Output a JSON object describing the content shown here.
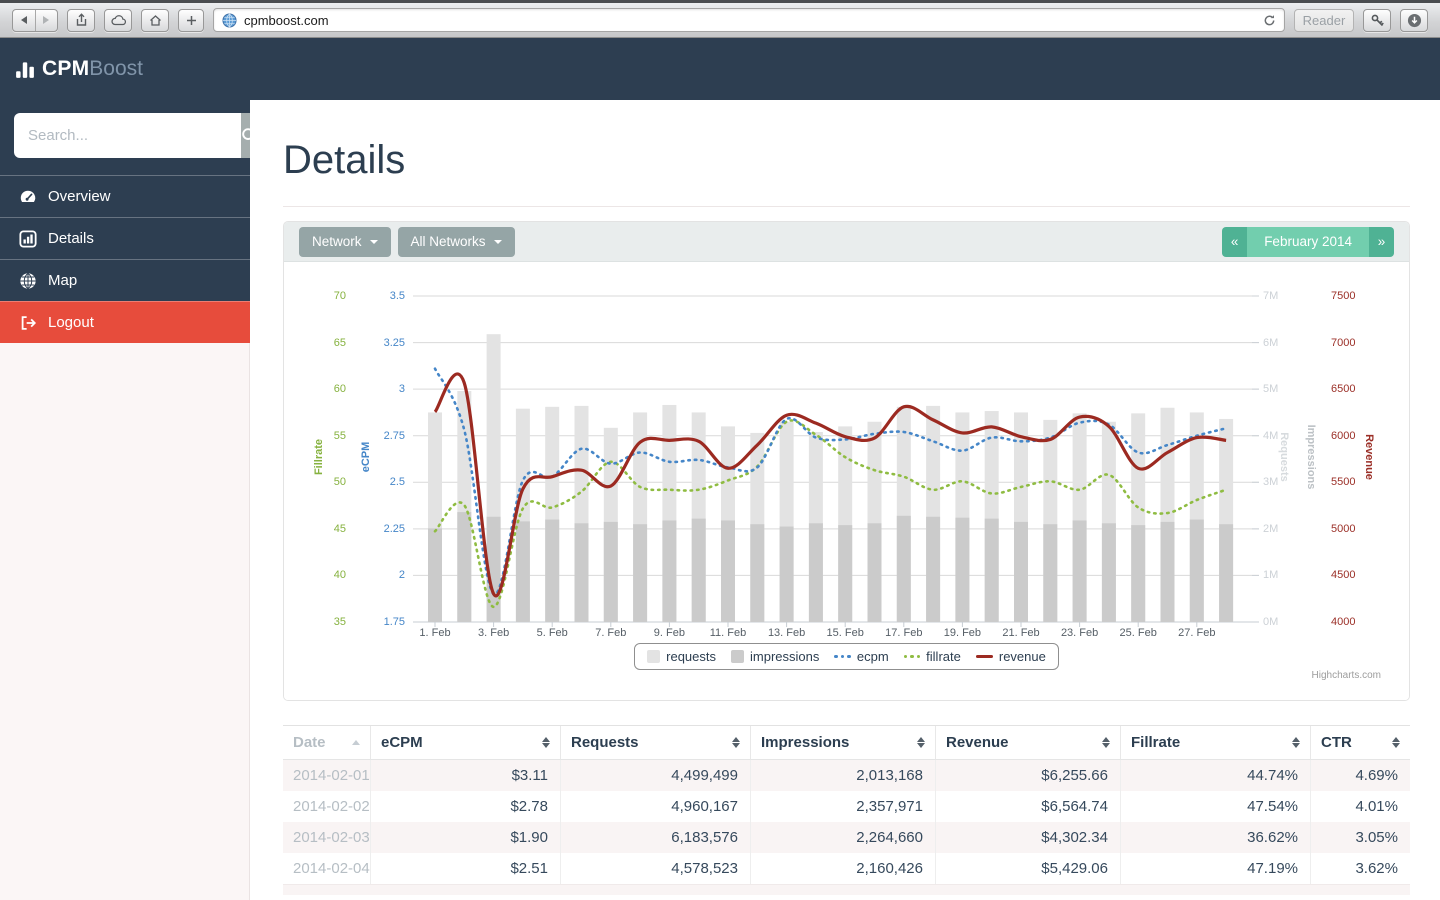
{
  "browser": {
    "url": "cpmboost.com",
    "reader_label": "Reader"
  },
  "navbar": {
    "brand_bold": "CPM",
    "brand_light": "Boost"
  },
  "sidebar": {
    "search_placeholder": "Search...",
    "items": [
      {
        "label": "Overview",
        "icon": "gauge-icon"
      },
      {
        "label": "Details",
        "icon": "bar-chart-icon"
      },
      {
        "label": "Map",
        "icon": "globe-icon"
      },
      {
        "label": "Logout",
        "icon": "logout-icon",
        "variant": "danger"
      }
    ]
  },
  "main": {
    "title": "Details",
    "toolbar": {
      "network_button": "Network",
      "all_networks_button": "All Networks",
      "pagination": {
        "prev": "«",
        "current": "February 2014",
        "next": "»"
      }
    },
    "credit": "Highcharts.com"
  },
  "chart_data": {
    "type": "combo",
    "x_tick_labels": [
      "1. Feb",
      "3. Feb",
      "5. Feb",
      "7. Feb",
      "9. Feb",
      "11. Feb",
      "13. Feb",
      "15. Feb",
      "17. Feb",
      "19. Feb",
      "21. Feb",
      "23. Feb",
      "25. Feb",
      "27. Feb"
    ],
    "days": 28,
    "series": [
      {
        "name": "requests",
        "type": "bar",
        "unit": "millions",
        "values": [
          4.5,
          4.96,
          6.18,
          4.58,
          4.62,
          4.64,
          4.17,
          4.5,
          4.66,
          4.5,
          4.2,
          4.06,
          4.3,
          4.08,
          4.2,
          4.3,
          4.62,
          4.64,
          4.5,
          4.53,
          4.5,
          4.34,
          4.48,
          4.3,
          4.48,
          4.6,
          4.5,
          4.36
        ]
      },
      {
        "name": "impressions",
        "type": "bar",
        "unit": "millions",
        "values": [
          2.01,
          2.36,
          2.26,
          2.16,
          2.2,
          2.12,
          2.15,
          2.1,
          2.18,
          2.22,
          2.18,
          2.1,
          2.05,
          2.12,
          2.08,
          2.12,
          2.28,
          2.26,
          2.24,
          2.22,
          2.15,
          2.1,
          2.18,
          2.12,
          2.08,
          2.15,
          2.2,
          2.1
        ]
      },
      {
        "name": "ecpm",
        "type": "dotted-line",
        "values": [
          3.11,
          2.78,
          1.9,
          2.51,
          2.53,
          2.68,
          2.6,
          2.66,
          2.61,
          2.62,
          2.58,
          2.58,
          2.84,
          2.74,
          2.73,
          2.76,
          2.77,
          2.72,
          2.67,
          2.74,
          2.72,
          2.74,
          2.82,
          2.81,
          2.66,
          2.7,
          2.75,
          2.79
        ]
      },
      {
        "name": "fillrate",
        "type": "dotted-line",
        "values": [
          44.74,
          47.54,
          36.62,
          47.19,
          47.3,
          49.0,
          52.2,
          49.5,
          49.2,
          49.2,
          50.2,
          51.7,
          56.5,
          55.1,
          52.7,
          51.3,
          50.6,
          49.2,
          50.1,
          48.8,
          49.5,
          50.1,
          49.2,
          50.8,
          47.3,
          46.7,
          48.1,
          49.2
        ]
      },
      {
        "name": "revenue",
        "type": "line",
        "values": [
          6255.66,
          6564.74,
          4302.34,
          5429.06,
          5560,
          5630,
          5460,
          5930,
          5950,
          5940,
          5650,
          5900,
          6220,
          6135,
          5990,
          5975,
          6310,
          6170,
          6030,
          6095,
          5990,
          5960,
          6200,
          6100,
          5650,
          5820,
          5980,
          5950
        ]
      }
    ],
    "axes": {
      "fillrate": {
        "title": "Fillrate",
        "color": "#86b23f",
        "min": 35,
        "max": 70,
        "ticks": [
          "70",
          "65",
          "60",
          "55",
          "50",
          "45",
          "40",
          "35"
        ]
      },
      "ecpm": {
        "title": "eCPM",
        "color": "#4586c8",
        "min": 1.75,
        "max": 3.5,
        "ticks": [
          "3.5",
          "3.25",
          "3",
          "2.75",
          "2.5",
          "2.25",
          "2",
          "1.75"
        ]
      },
      "volume": {
        "titles": [
          "Requests",
          "Impressions"
        ],
        "colors": [
          "#d7dbde",
          "#bcc1c5"
        ],
        "tick_color": "#ccd1d6",
        "min": 0,
        "max": 7,
        "ticks": [
          "7M",
          "6M",
          "5M",
          "4M",
          "3M",
          "2M",
          "1M",
          "0M"
        ]
      },
      "revenue": {
        "title": "Revenue",
        "color": "#9b2f27",
        "min": 4000,
        "max": 7500,
        "ticks": [
          "7500",
          "7000",
          "6500",
          "6000",
          "5500",
          "5000",
          "4500",
          "4000"
        ]
      }
    },
    "legend": [
      {
        "label": "requests",
        "swatch": "square",
        "color": "#e3e3e3"
      },
      {
        "label": "impressions",
        "swatch": "square",
        "color": "#cbcbcb"
      },
      {
        "label": "ecpm",
        "swatch": "dots",
        "color": "#4586c8"
      },
      {
        "label": "fillrate",
        "swatch": "dots",
        "color": "#8fbc42"
      },
      {
        "label": "revenue",
        "swatch": "line",
        "color": "#9c2a21"
      }
    ],
    "grid": true,
    "legend_position": "bottom-center"
  },
  "table": {
    "columns": [
      {
        "label": "Date",
        "sort": "asc"
      },
      {
        "label": "eCPM",
        "sort": "both"
      },
      {
        "label": "Requests",
        "sort": "both"
      },
      {
        "label": "Impressions",
        "sort": "both"
      },
      {
        "label": "Revenue",
        "sort": "both"
      },
      {
        "label": "Fillrate",
        "sort": "both"
      },
      {
        "label": "CTR",
        "sort": "both"
      }
    ],
    "rows": [
      [
        "2014-02-01",
        "$3.11",
        "4,499,499",
        "2,013,168",
        "$6,255.66",
        "44.74%",
        "4.69%"
      ],
      [
        "2014-02-02",
        "$2.78",
        "4,960,167",
        "2,357,971",
        "$6,564.74",
        "47.54%",
        "4.01%"
      ],
      [
        "2014-02-03",
        "$1.90",
        "6,183,576",
        "2,264,660",
        "$4,302.34",
        "36.62%",
        "3.05%"
      ],
      [
        "2014-02-04",
        "$2.51",
        "4,578,523",
        "2,160,426",
        "$5,429.06",
        "47.19%",
        "3.62%"
      ]
    ]
  },
  "colors": {
    "navy": "#2d3e51",
    "danger": "#e74c3c",
    "teal_dark": "#4fb294",
    "teal_light": "#72ceae",
    "button_gray": "#95a5a6",
    "requests_bar": "#e3e3e3",
    "impressions_bar": "#cbcbcb",
    "ecpm_line": "#4586c8",
    "fillrate_line": "#8fbc42",
    "revenue_line": "#9c2a21",
    "grid": "#d9d9d9",
    "stripe": "#f9f4f4"
  }
}
